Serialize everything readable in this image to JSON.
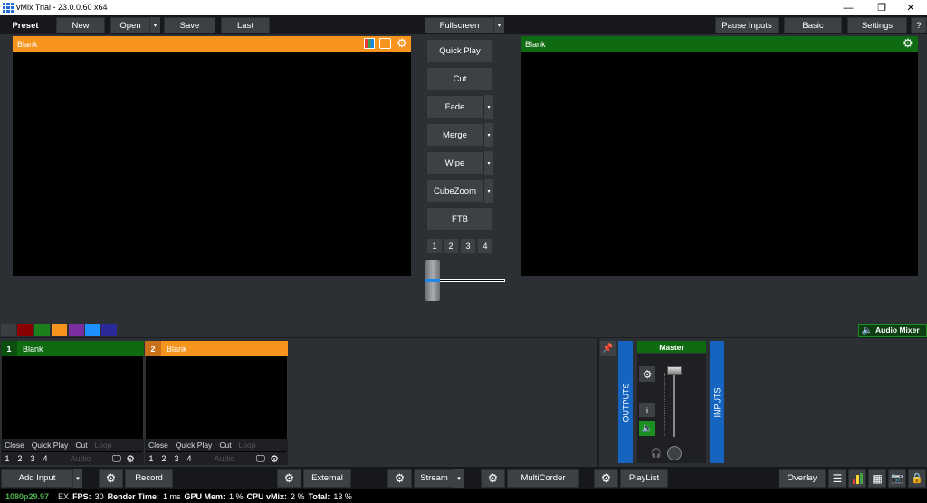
{
  "window": {
    "title": "vMix Trial - 23.0.0.60 x64",
    "minimize": "—",
    "restore": "❐",
    "close": "✕"
  },
  "toolbar": {
    "preset": "Preset",
    "new": "New",
    "open": "Open",
    "save": "Save",
    "last": "Last",
    "fullscreen": "Fullscreen",
    "pause_inputs": "Pause Inputs",
    "basic": "Basic",
    "settings": "Settings",
    "help": "?",
    "caret": "▾"
  },
  "preview": {
    "title": "Blank"
  },
  "output": {
    "title": "Blank"
  },
  "transitions": {
    "quick_play": "Quick Play",
    "cut": "Cut",
    "fade": "Fade",
    "merge": "Merge",
    "wipe": "Wipe",
    "cubezoom": "CubeZoom",
    "ftb": "FTB",
    "numbers": [
      "1",
      "2",
      "3",
      "4"
    ]
  },
  "colors": {
    "swatches": [
      "#3a3d42",
      "#8b0000",
      "#1b7f1b",
      "#f7941d",
      "#7b2ea0",
      "#1e90ff",
      "#2a2a9a"
    ]
  },
  "audio_mixer": {
    "label": "Audio Mixer",
    "master": "Master",
    "outputs": "OUTPUTS",
    "inputs": "INPUTS",
    "info": "i"
  },
  "inputs": [
    {
      "num": "1",
      "name": "Blank",
      "color": "#0e6b12",
      "numbg": "#0e6b12",
      "close": "Close",
      "quick_play": "Quick Play",
      "cut": "Cut",
      "loop": "Loop",
      "overlays": [
        "1",
        "2",
        "3",
        "4"
      ],
      "audio": "Audio"
    },
    {
      "num": "2",
      "name": "Blank",
      "color": "#f7941d",
      "numbg": "#c8701a",
      "close": "Close",
      "quick_play": "Quick Play",
      "cut": "Cut",
      "loop": "Loop",
      "overlays": [
        "1",
        "2",
        "3",
        "4"
      ],
      "audio": "Audio"
    }
  ],
  "bottombar": {
    "add_input": "Add Input",
    "record": "Record",
    "external": "External",
    "stream": "Stream",
    "multicorder": "MultiCorder",
    "playlist": "PlayList",
    "overlay": "Overlay"
  },
  "status": {
    "format": "1080p29.97",
    "ex": "EX",
    "fps_label": "FPS:",
    "fps": "30",
    "render_label": "Render Time:",
    "render": "1 ms",
    "gpu_label": "GPU Mem:",
    "gpu": "1 %",
    "cpu_label": "CPU vMix:",
    "cpu": "2 %",
    "total_label": "Total:",
    "total": "13 %"
  }
}
